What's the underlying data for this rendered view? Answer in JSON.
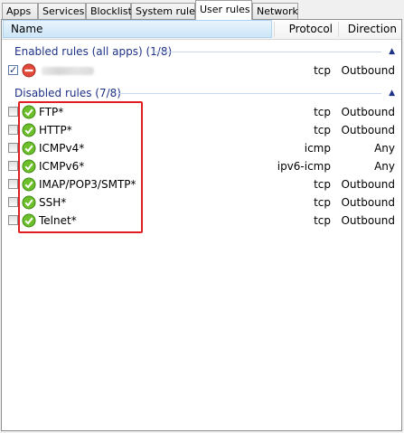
{
  "tabs": [
    {
      "label": "Apps",
      "active": false
    },
    {
      "label": "Services",
      "active": false
    },
    {
      "label": "Blocklist",
      "active": false
    },
    {
      "label": "System rules",
      "active": false
    },
    {
      "label": "User rules",
      "active": true
    },
    {
      "label": "Network",
      "active": false
    }
  ],
  "columns": {
    "name": "Name",
    "protocol": "Protocol",
    "direction": "Direction"
  },
  "groups": {
    "enabled": {
      "title": "Enabled rules (all apps) (1/8)",
      "rows": [
        {
          "name": "",
          "protocol": "tcp",
          "direction": "Outbound",
          "checked": true,
          "icon": "block-icon"
        }
      ]
    },
    "disabled": {
      "title": "Disabled rules (7/8)",
      "rows": [
        {
          "name": "FTP*",
          "protocol": "tcp",
          "direction": "Outbound",
          "checked": false,
          "icon": "allow-icon"
        },
        {
          "name": "HTTP*",
          "protocol": "tcp",
          "direction": "Outbound",
          "checked": false,
          "icon": "allow-icon"
        },
        {
          "name": "ICMPv4*",
          "protocol": "icmp",
          "direction": "Any",
          "checked": false,
          "icon": "allow-icon"
        },
        {
          "name": "ICMPv6*",
          "protocol": "ipv6-icmp",
          "direction": "Any",
          "checked": false,
          "icon": "allow-icon"
        },
        {
          "name": "IMAP/POP3/SMTP*",
          "protocol": "tcp",
          "direction": "Outbound",
          "checked": false,
          "icon": "allow-icon"
        },
        {
          "name": "SSH*",
          "protocol": "tcp",
          "direction": "Outbound",
          "checked": false,
          "icon": "allow-icon"
        },
        {
          "name": "Telnet*",
          "protocol": "tcp",
          "direction": "Outbound",
          "checked": false,
          "icon": "allow-icon"
        }
      ]
    }
  },
  "colors": {
    "group_text": "#1e3287",
    "allow_icon": "#6cbf2a",
    "block_icon": "#e0483a",
    "highlight": "#e02020"
  }
}
